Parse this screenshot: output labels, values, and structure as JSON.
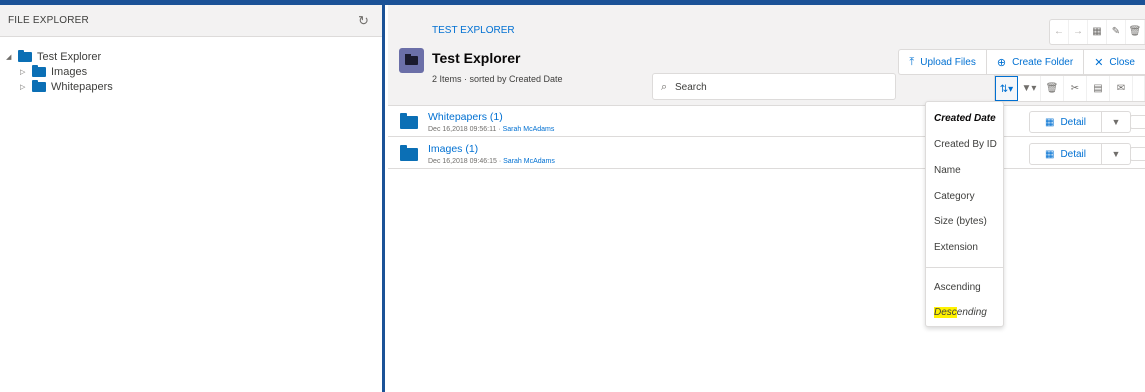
{
  "left_panel": {
    "title": "FILE EXPLORER",
    "tree": [
      {
        "label": "Test Explorer",
        "expanded": true,
        "depth": 0
      },
      {
        "label": "Images",
        "expanded": false,
        "depth": 1
      },
      {
        "label": "Whitepapers",
        "expanded": false,
        "depth": 1
      }
    ]
  },
  "header": {
    "breadcrumb": "TEST EXPLORER",
    "title": "Test Explorer",
    "subtitle": "2 Items · sorted by Created Date",
    "upload_label": "Upload Files",
    "create_folder_label": "Create Folder",
    "close_label": "Close"
  },
  "search": {
    "placeholder": "Search"
  },
  "rows": [
    {
      "name": "Whitepapers (1)",
      "date": "Dec 16,2018 09:56:11",
      "sep": " · ",
      "user": "Sarah McAdams",
      "detail_label": "Detail"
    },
    {
      "name": "Images (1)",
      "date": "Dec 16,2018 09:46:15",
      "sep": " · ",
      "user": "Sarah McAdams",
      "detail_label": "Detail"
    }
  ],
  "sort_menu": {
    "fields": [
      "Created Date",
      "Created By ID",
      "Name",
      "Category",
      "Size (bytes)",
      "Extension"
    ],
    "selected_field": "Created Date",
    "ascending": "Ascending",
    "descending_highlight": "Desc",
    "descending_rest": "ending",
    "selected_order": "Descending"
  },
  "colors": {
    "accent": "#0070d2",
    "folder": "#0b6fb5",
    "frame": "#1b5297",
    "highlight": "#fff200"
  }
}
